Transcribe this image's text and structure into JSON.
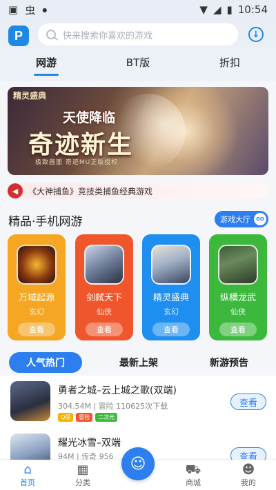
{
  "status": {
    "time": "10:54"
  },
  "header": {
    "logo_letter": "P",
    "search_placeholder": "快来搜索你喜欢的游戏"
  },
  "tabs": [
    {
      "label": "网游"
    },
    {
      "label": "BT版"
    },
    {
      "label": "折扣"
    }
  ],
  "banner": {
    "brand": "精灵盛典",
    "subtitle": "天使降临",
    "title": "奇迹新生",
    "tagline": "极致画面 奇迹MU正版授权"
  },
  "notice": {
    "text": "《大神捕鱼》竞技类捕鱼经典游戏"
  },
  "section": {
    "title": "精品·手机网游",
    "hall_label": "游戏大厅",
    "hall_go": "GO"
  },
  "featured": [
    {
      "name": "万域起源",
      "category": "玄幻",
      "button": "查看",
      "color": "#f5a623"
    },
    {
      "name": "剑弑天下",
      "category": "仙侠",
      "button": "查看",
      "color": "#f0562c"
    },
    {
      "name": "精灵盛典",
      "category": "玄幻",
      "button": "查看",
      "color": "#1e8ff0"
    },
    {
      "name": "纵横龙武",
      "category": "仙侠",
      "button": "查看",
      "color": "#3cb93c"
    }
  ],
  "list_tabs": [
    {
      "label": "人气热门"
    },
    {
      "label": "最新上架"
    },
    {
      "label": "新游预告"
    }
  ],
  "games": [
    {
      "name": "勇者之城–云上城之歌(双端)",
      "meta": "304.54M | 冒险  110625次下载",
      "tags": [
        "Q版",
        "冒险",
        "二次元"
      ],
      "button": "查看"
    },
    {
      "name": "耀光冰雪–双端",
      "meta": "94M | 传奇  956",
      "tags": [],
      "button": "查看"
    }
  ],
  "bottom_nav": [
    {
      "label": "首页"
    },
    {
      "label": "分类"
    },
    {
      "label": "商城"
    },
    {
      "label": "我的"
    }
  ]
}
